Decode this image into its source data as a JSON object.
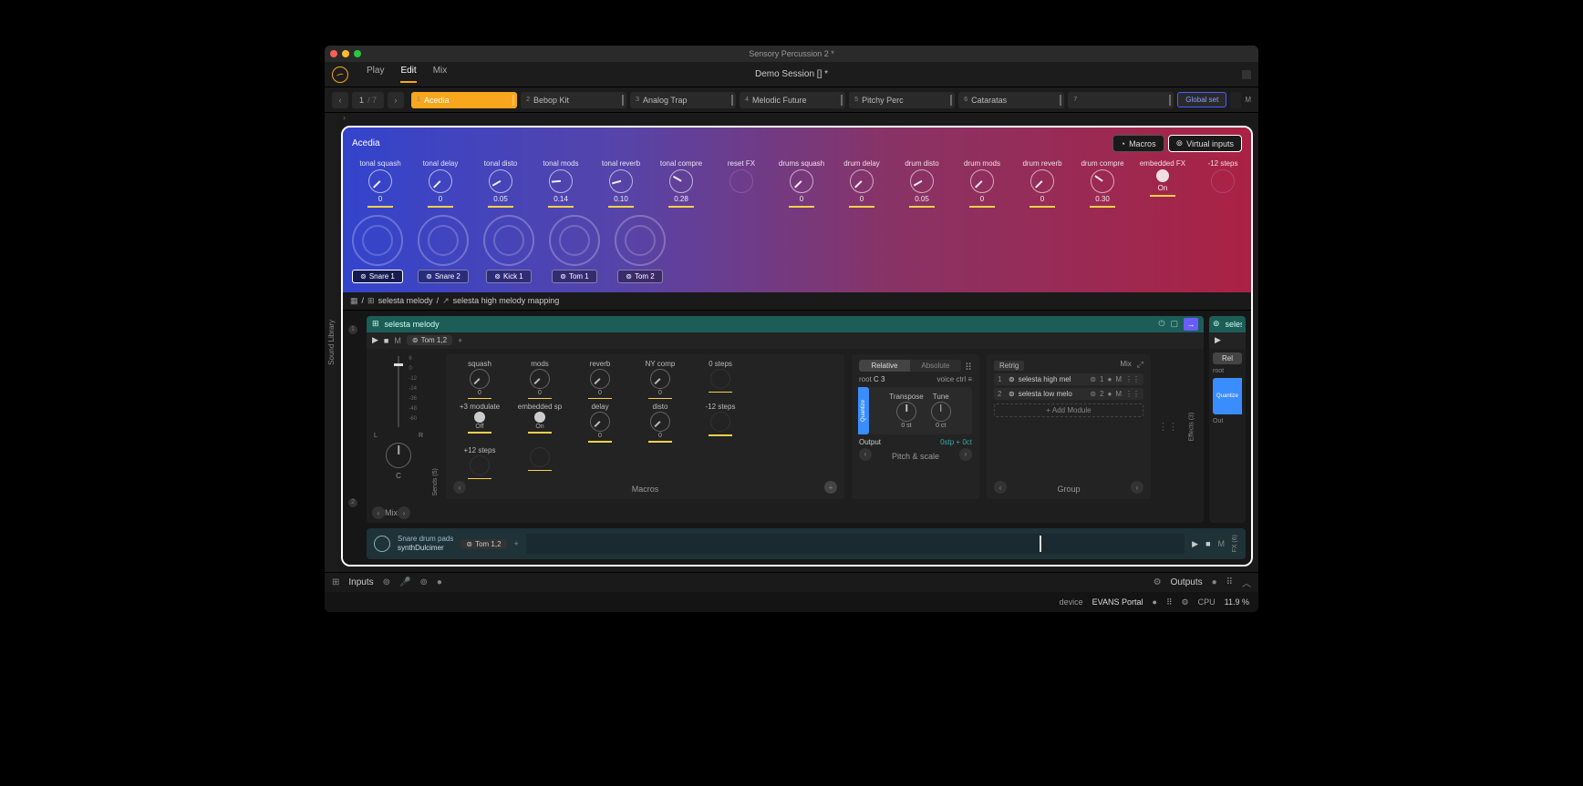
{
  "titlebar": {
    "title": "Sensory Percussion 2 *"
  },
  "topbar": {
    "tabs": [
      "Play",
      "Edit",
      "Mix"
    ],
    "active_tab": "Edit",
    "session": "Demo Session [] *"
  },
  "setbar": {
    "page_current": "1",
    "page_total": "/ 7",
    "sets": [
      {
        "num": "1",
        "label": "Acedia",
        "active": true
      },
      {
        "num": "2",
        "label": "Bebop Kit"
      },
      {
        "num": "3",
        "label": "Analog Trap"
      },
      {
        "num": "4",
        "label": "Melodic Future"
      },
      {
        "num": "5",
        "label": "Pitchy Perc"
      },
      {
        "num": "6",
        "label": "Cataratas"
      },
      {
        "num": "7",
        "label": ""
      }
    ],
    "global_set": "Global set"
  },
  "set_header": {
    "title": "Acedia",
    "macros_btn": "Macros",
    "vinputs_btn": "Virtual inputs",
    "macros": [
      {
        "label": "tonal squash",
        "val": "0",
        "rot": -135
      },
      {
        "label": "tonal delay",
        "val": "0",
        "rot": -135
      },
      {
        "label": "tonal disto",
        "val": "0.05",
        "rot": -120
      },
      {
        "label": "tonal mods",
        "val": "0.14",
        "rot": -95
      },
      {
        "label": "tonal reverb",
        "val": "0.10",
        "rot": -105
      },
      {
        "label": "tonal compre",
        "val": "0.28",
        "rot": -60
      },
      {
        "label": "reset FX",
        "val": "",
        "empty": true
      },
      {
        "label": "drums squash",
        "val": "0",
        "rot": -135
      },
      {
        "label": "drum delay",
        "val": "0",
        "rot": -135
      },
      {
        "label": "drum disto",
        "val": "0.05",
        "rot": -120
      },
      {
        "label": "drum mods",
        "val": "0",
        "rot": -135
      },
      {
        "label": "drum reverb",
        "val": "0",
        "rot": -135
      },
      {
        "label": "drum compre",
        "val": "0.30",
        "rot": -55
      },
      {
        "label": "embedded FX",
        "val": "On",
        "toggle": true
      },
      {
        "label": "-12 steps",
        "val": "",
        "empty": true
      }
    ],
    "vinputs": [
      {
        "label": "Snare  1",
        "active": true
      },
      {
        "label": "Snare  2"
      },
      {
        "label": "Kick  1"
      },
      {
        "label": "Tom  1"
      },
      {
        "label": "Tom  2"
      }
    ]
  },
  "breadcrumb": {
    "root_icon": "grid",
    "parts": [
      "selesta melody",
      "selesta high melody mapping"
    ]
  },
  "module": {
    "header_name": "selesta melody",
    "assign_chip": "Tom  1,2",
    "db_scale": [
      "6",
      "0",
      "-12",
      "-24",
      "-36",
      "-48",
      "-60"
    ],
    "pan_l": "L",
    "pan_r": "R",
    "pan_c": "C",
    "sends_label": "Sends (5)",
    "mix_label": "Mix",
    "macros_label": "Macros",
    "macros": [
      {
        "label": "squash",
        "val": "0",
        "rot": -135
      },
      {
        "label": "mods",
        "val": "0",
        "rot": -135
      },
      {
        "label": "reverb",
        "val": "0",
        "rot": -135
      },
      {
        "label": "NY comp",
        "val": "0",
        "rot": -135
      },
      {
        "label": "0 steps",
        "val": "",
        "empty": true
      },
      {
        "label": "+3 modulate",
        "val": "Off",
        "toggle": true
      },
      {
        "label": "embedded sp",
        "val": "On",
        "toggle": true
      },
      {
        "label": "delay",
        "val": "0",
        "rot": -135
      },
      {
        "label": "disto",
        "val": "0",
        "rot": -135
      },
      {
        "label": "-12 steps",
        "val": "",
        "empty": true
      },
      {
        "label": "+12 steps",
        "val": "",
        "empty": true
      },
      {
        "label": "",
        "val": "",
        "empty": true
      }
    ],
    "pitch": {
      "modes": [
        "Relative",
        "Absolute"
      ],
      "active_mode": "Relative",
      "root_label": "root",
      "root_val": "C  3",
      "voice_label": "voice ctrl",
      "quantize": "Quantize",
      "transpose_label": "Transpose",
      "transpose_val": "0 st",
      "tune_label": "Tune",
      "tune_val": "0 ct",
      "output_label": "Output",
      "output_val": "0stp + 0ct",
      "section_label": "Pitch & scale"
    },
    "group": {
      "retrig": "Retrig",
      "mix_label": "Mix",
      "items": [
        {
          "idx": "1",
          "name": "selesta high mel",
          "chan": "1"
        },
        {
          "idx": "2",
          "name": "selesta low melo",
          "chan": "2"
        }
      ],
      "add": "+ Add Module",
      "section_label": "Group"
    },
    "effects_label": "Effects (3)",
    "peek_name": "seles",
    "peek_mode": "Rel",
    "peek_output": "Out"
  },
  "lane2": {
    "name_top": "Snare drum pads",
    "name_bottom": "synthDulcimer",
    "assign": "Tom  1,2",
    "fx_label": "FX (6)"
  },
  "bottombar": {
    "inputs": "Inputs",
    "outputs": "Outputs"
  },
  "statusbar": {
    "device_label": "device",
    "device_name": "EVANS Portal",
    "cpu_label": "CPU",
    "cpu_val": "11.9 %"
  },
  "sound_library": "Sound Library"
}
